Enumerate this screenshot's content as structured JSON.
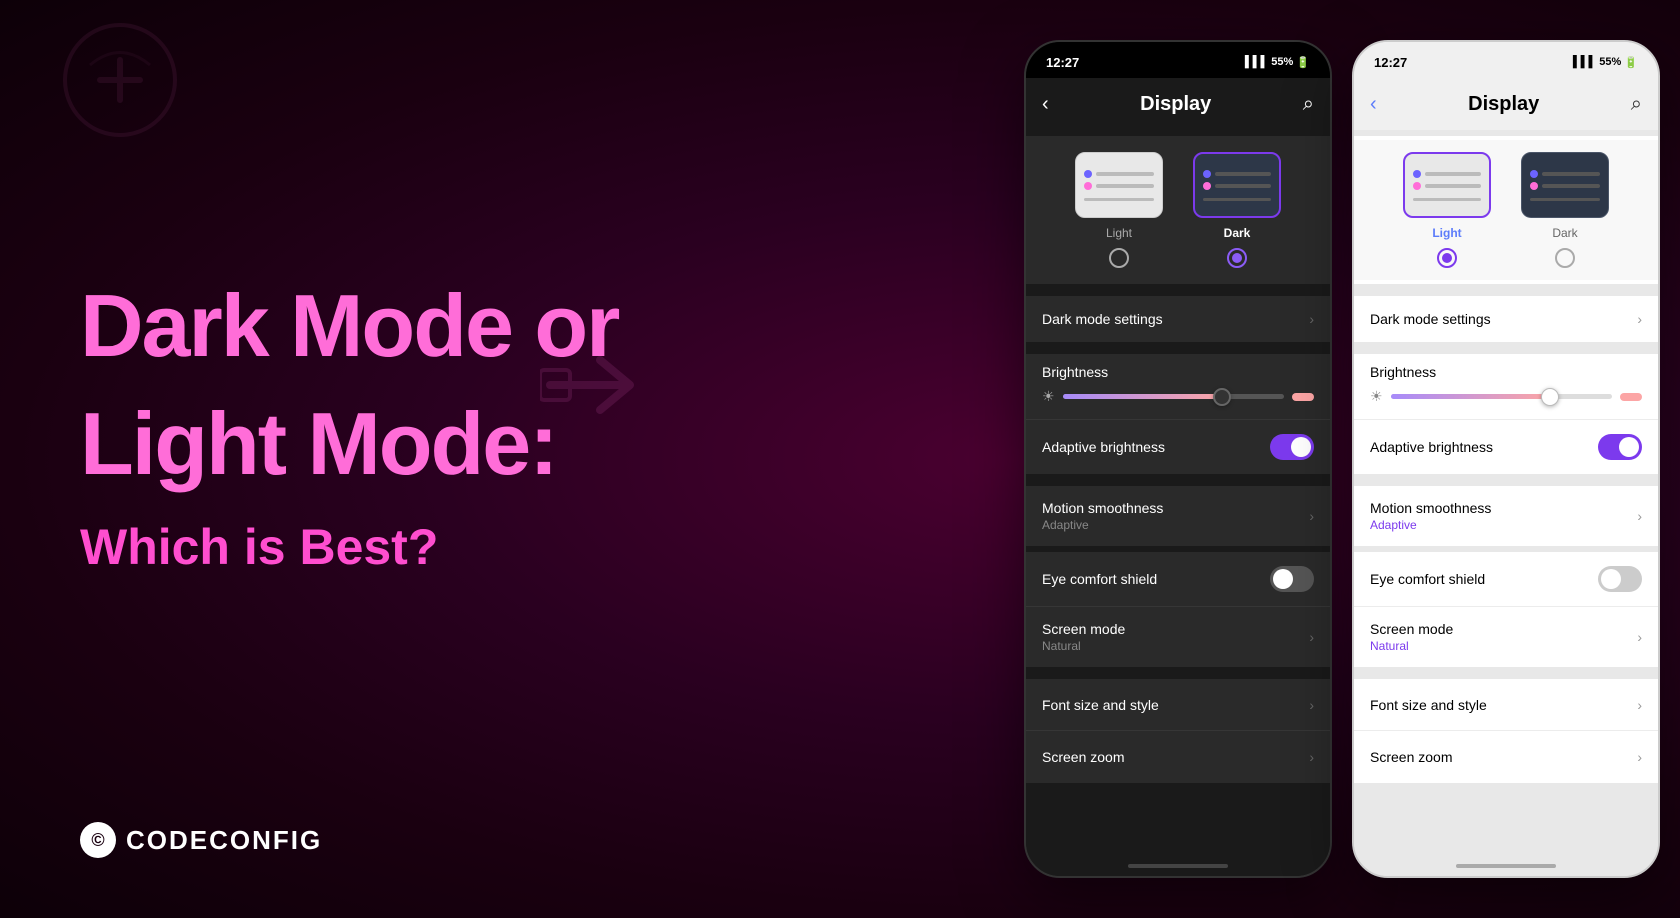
{
  "background": {
    "color": "#2a0018"
  },
  "left": {
    "headline_line1": "Dark Mode or",
    "headline_line2": "Light Mode:",
    "subheadline": "Which is Best?",
    "brand_name": "CODECONFIG"
  },
  "phone_dark": {
    "status_time": "12:27",
    "status_battery": "55%",
    "header_title": "Display",
    "header_back": "‹",
    "header_search": "🔍",
    "theme_light_label": "Light",
    "theme_dark_label": "Dark",
    "dark_mode_settings": "Dark mode settings",
    "brightness_label": "Brightness",
    "adaptive_brightness": "Adaptive brightness",
    "motion_smoothness": "Motion smoothness",
    "motion_smoothness_sub": "Adaptive",
    "eye_comfort": "Eye comfort shield",
    "screen_mode": "Screen mode",
    "screen_mode_sub": "Natural",
    "font_size": "Font size and style",
    "screen_zoom": "Screen zoom"
  },
  "phone_light": {
    "status_time": "12:27",
    "status_battery": "55%",
    "header_title": "Display",
    "header_back": "‹",
    "header_search": "🔍",
    "theme_light_label": "Light",
    "theme_dark_label": "Dark",
    "dark_mode_settings": "Dark mode settings",
    "brightness_label": "Brightness",
    "adaptive_brightness": "Adaptive brightness",
    "motion_smoothness": "Motion smoothness",
    "motion_smoothness_sub": "Adaptive",
    "eye_comfort": "Eye comfort shield",
    "screen_mode": "Screen mode",
    "screen_mode_sub": "Natural",
    "font_size": "Font size and style",
    "screen_zoom": "Screen zoom"
  }
}
